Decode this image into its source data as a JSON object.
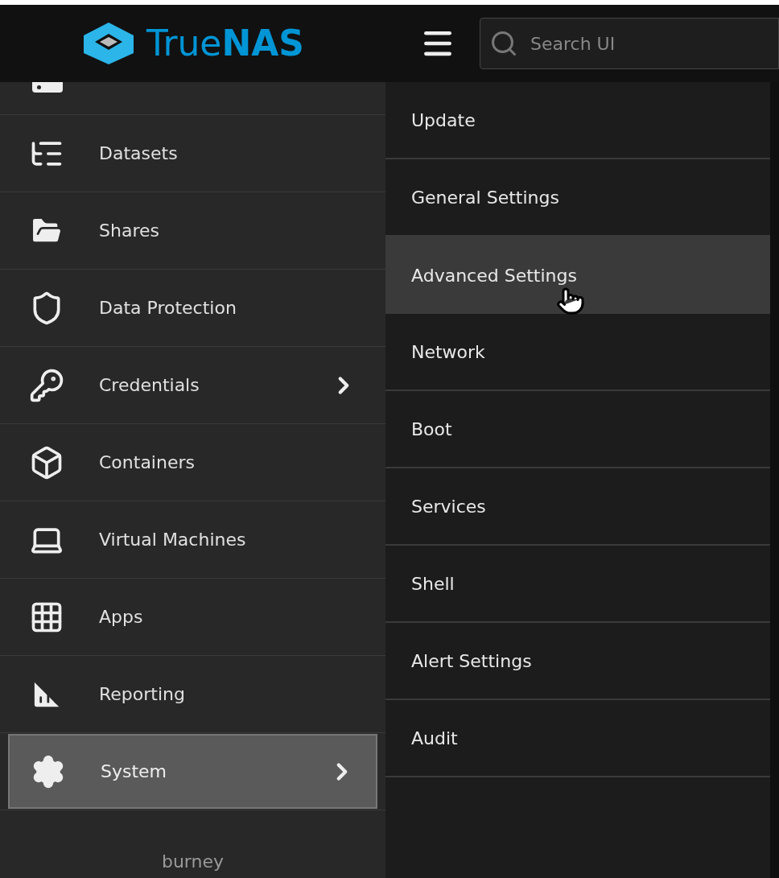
{
  "header": {
    "logo": "True**NAS**",
    "search": {
      "placeholder": "Search UI"
    }
  },
  "sidebar": {
    "items": [
      {
        "label": "Datasets",
        "has_submenu": false,
        "selected": false
      },
      {
        "label": "Shares",
        "has_submenu": false,
        "selected": false
      },
      {
        "label": "Data Protection",
        "has_submenu": false,
        "selected": false
      },
      {
        "label": "Credentials",
        "has_submenu": true,
        "selected": false
      },
      {
        "label": "Containers",
        "has_submenu": false,
        "selected": false
      },
      {
        "label": "Virtual Machines",
        "has_submenu": false,
        "selected": false
      },
      {
        "label": "Apps",
        "has_submenu": false,
        "selected": false
      },
      {
        "label": "Reporting",
        "has_submenu": false,
        "selected": false
      },
      {
        "label": "System",
        "has_submenu": true,
        "selected": true
      }
    ],
    "hostname": "burney"
  },
  "submenu": {
    "items": [
      {
        "label": "Update",
        "hovered": false
      },
      {
        "label": "General Settings",
        "hovered": false
      },
      {
        "label": "Advanced Settings",
        "hovered": true
      },
      {
        "label": "Network",
        "hovered": false
      },
      {
        "label": "Boot",
        "hovered": false
      },
      {
        "label": "Services",
        "hovered": false
      },
      {
        "label": "Shell",
        "hovered": false
      },
      {
        "label": "Alert Settings",
        "hovered": false
      },
      {
        "label": "Audit",
        "hovered": false
      }
    ]
  }
}
